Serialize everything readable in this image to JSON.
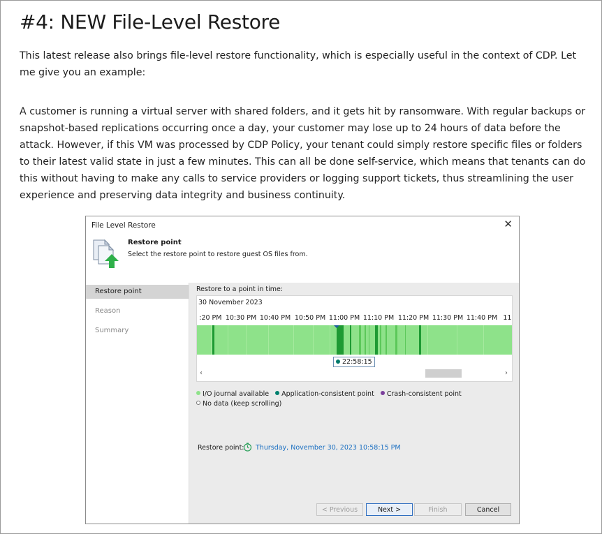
{
  "article": {
    "heading": "#4: NEW File-Level Restore",
    "paragraph1": "This latest release also brings file-level restore functionality, which is especially useful in the context of CDP. Let me give you an example:",
    "paragraph2": "A customer is running a virtual server with shared folders, and it gets hit by ransomware. With regular backups or snapshot-based replications occurring once a day, your customer may lose up to 24 hours of data before the attack. However, if this VM was processed by CDP Policy, your tenant could simply restore specific files or folders to their latest valid state in just a few minutes. This can all be done self-service, which means that tenants can do this without having to make any calls to service providers or logging support tickets, thus streamlining the user experience and preserving data integrity and business continuity."
  },
  "dialog": {
    "title": "File Level Restore",
    "close_glyph": "✕",
    "header_title": "Restore point",
    "header_subtitle": "Select the restore point to restore guest OS files from.",
    "steps": [
      {
        "label": "Restore point",
        "active": true
      },
      {
        "label": "Reason",
        "active": false
      },
      {
        "label": "Summary",
        "active": false
      }
    ],
    "restore_label": "Restore to a point in time:",
    "date": "30 November 2023",
    "ticks": [
      ") :20 PM",
      "10:30 PM",
      "10:40 PM",
      "10:50 PM",
      "11:00 PM",
      "11:10 PM",
      "11:20 PM",
      "11:30 PM",
      "11:40 PM",
      "11:"
    ],
    "selected_time": "22:58:15",
    "scroll_left": "‹",
    "scroll_right": "›",
    "legend": {
      "io": "I/O journal available",
      "app": "Application-consistent point",
      "crash": "Crash-consistent point",
      "nodata": "No data (keep scrolling)"
    },
    "restore_point_label": "Restore point:",
    "restore_point_value": "Thursday, November 30, 2023 10:58:15 PM",
    "buttons": {
      "previous": "< Previous",
      "next": "Next >",
      "finish": "Finish",
      "cancel": "Cancel"
    },
    "colors": {
      "io_green": "#8ee28a",
      "app_teal": "#00806e",
      "crash_purple": "#7b3f9c",
      "link_blue": "#1a6fc1"
    },
    "icons": {
      "header": "file-restore-icon",
      "restore_point": "clock-restore-icon",
      "close": "close-icon"
    }
  }
}
